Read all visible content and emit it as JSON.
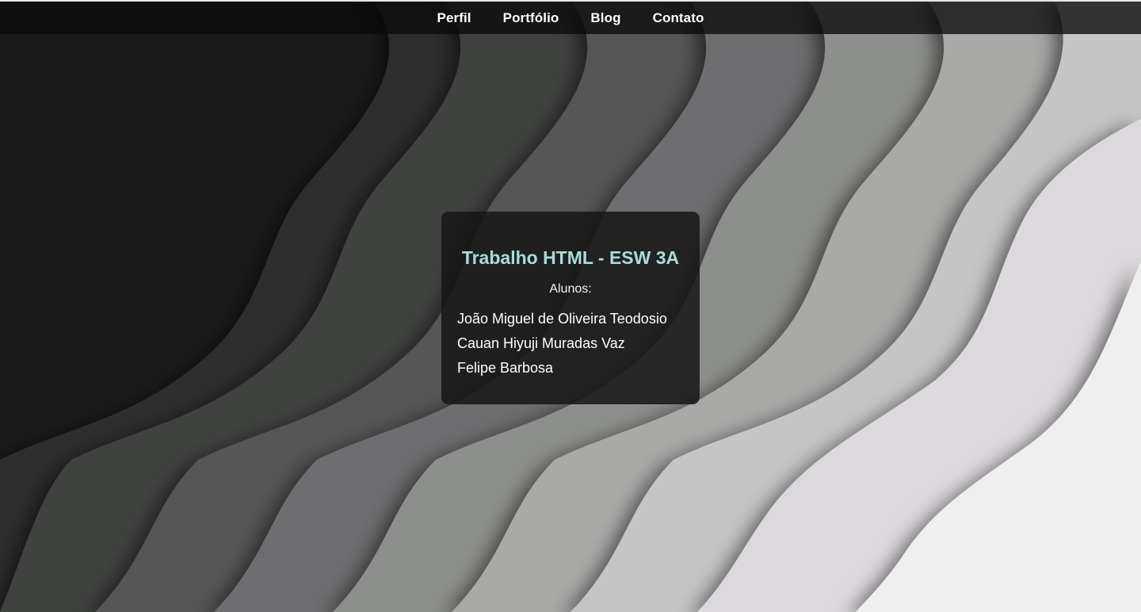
{
  "nav": {
    "items": [
      {
        "label": "Perfil"
      },
      {
        "label": "Portfólio"
      },
      {
        "label": "Blog"
      },
      {
        "label": "Contato"
      }
    ]
  },
  "card": {
    "title": "Trabalho HTML - ESW 3A",
    "subtitle": "Alunos:",
    "students": [
      "João Miguel de Oliveira Teodosio",
      "Cauan Hiyuji Muradas Vaz",
      "Felipe Barbosa"
    ]
  },
  "colors": {
    "title_accent": "#a9dcdc",
    "card_background": "#161616",
    "navbar_background": "#0a0a0a"
  }
}
